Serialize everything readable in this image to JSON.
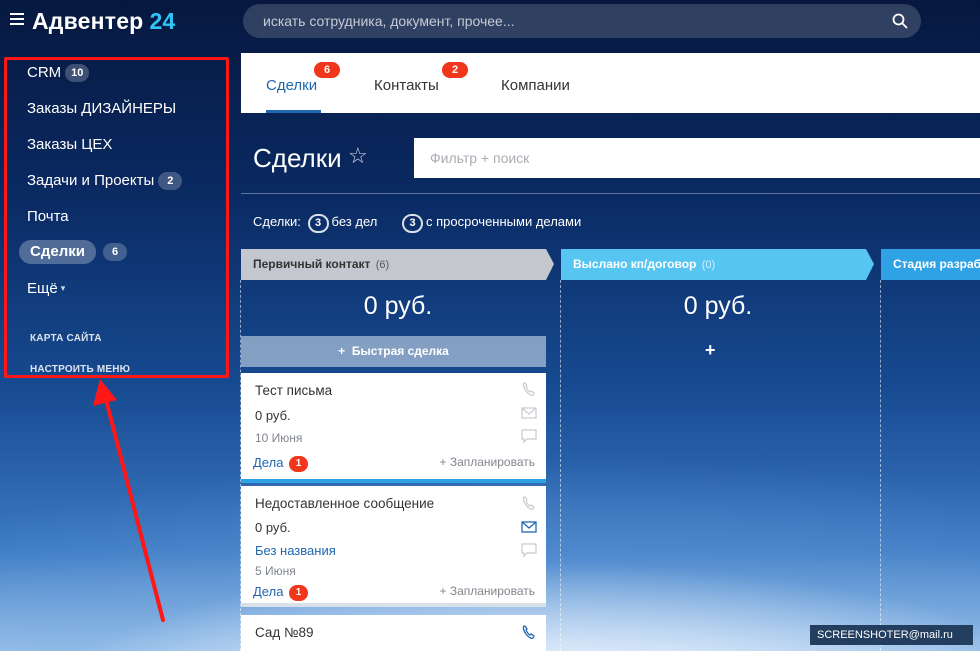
{
  "app": {
    "title": "Адвентер",
    "title_num": "24"
  },
  "search": {
    "placeholder": "искать сотрудника, документ, прочее..."
  },
  "sidebar": {
    "items": [
      {
        "label": "CRM",
        "count": "10"
      },
      {
        "label": "Заказы ДИЗАЙНЕРЫ"
      },
      {
        "label": "Заказы ЦЕХ"
      },
      {
        "label": "Задачи и Проекты",
        "count": "2"
      },
      {
        "label": "Почта"
      },
      {
        "label": "Сделки",
        "count": "6"
      },
      {
        "label": "Ещё"
      }
    ],
    "site_map": "КАРТА САЙТА",
    "configure_menu": "НАСТРОИТЬ МЕНЮ"
  },
  "tabs": [
    {
      "label": "Сделки",
      "badge": "6"
    },
    {
      "label": "Контакты",
      "badge": "2"
    },
    {
      "label": "Компании"
    }
  ],
  "page": {
    "title": "Сделки",
    "star": "☆",
    "filter_placeholder": "Фильтр + поиск",
    "counters": {
      "label": "Сделки:",
      "no_tasks_count": "3",
      "no_tasks_label": "без дел",
      "overdue_count": "3",
      "overdue_label": "с просроченными делами"
    }
  },
  "stages": [
    {
      "name": "Первичный контакт",
      "count": "(6)",
      "sum": "0 руб.",
      "color": "#c2c6cc"
    },
    {
      "name": "Выслано кп/договор",
      "count": "(0)",
      "sum": "0 руб.",
      "color": "#57c5f2"
    },
    {
      "name": "Стадия разраб",
      "color": "#2fa2e6"
    }
  ],
  "quick_deal": "Быстрая сделка",
  "cards": [
    {
      "title": "Тест письма",
      "amount": "0 руб.",
      "date": "10 Июня",
      "deals_label": "Дела",
      "deals_count": "1",
      "plan": "+ Запланировать"
    },
    {
      "title": "Недоставленное сообщение",
      "amount": "0 руб.",
      "contact": "Без названия",
      "date": "5 Июня",
      "deals_label": "Дела",
      "deals_count": "1",
      "plan": "+ Запланировать"
    },
    {
      "title": "Сад №89"
    }
  ],
  "watermark": "SCREENSHOTER@mail.ru",
  "colors": {
    "accent": "#2067b0",
    "badge_red": "#f1361b",
    "highlight_frame": "#ff1616",
    "logo_num": "#2fc6f6"
  }
}
